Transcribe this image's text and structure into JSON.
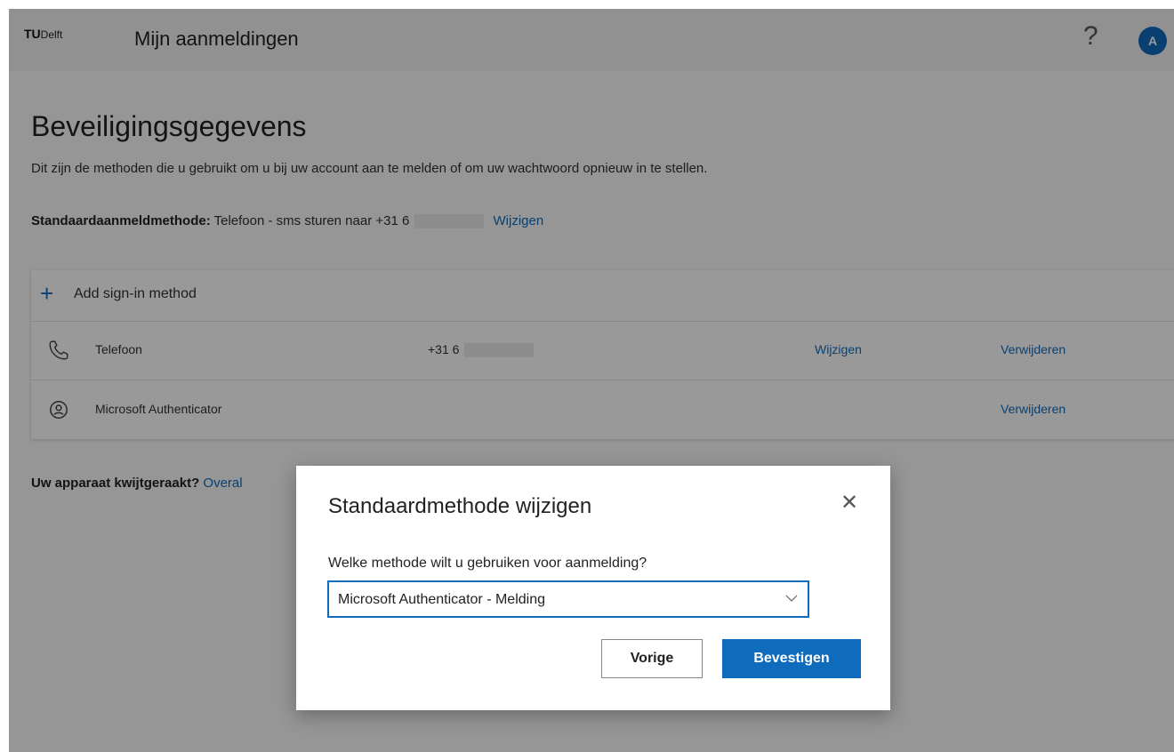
{
  "header": {
    "logo_tu": "TU",
    "logo_delft": "Delft",
    "app_title": "Mijn aanmeldingen",
    "help_symbol": "?",
    "avatar_initial": "A"
  },
  "main": {
    "title": "Beveiligingsgegevens",
    "subtitle": "Dit zijn de methoden die u gebruikt om u bij uw account aan te melden of om uw wachtwoord opnieuw in te stellen.",
    "default_label": "Standaardaanmeldmethode:",
    "default_value": "Telefoon - sms sturen naar +31 6",
    "default_change": "Wijzigen",
    "add_method": "Add sign-in method",
    "methods": [
      {
        "name": "Telefoon",
        "value": "+31 6",
        "change": "Wijzigen",
        "remove": "Verwijderen",
        "icon": "phone-icon"
      },
      {
        "name": "Microsoft Authenticator",
        "value": "",
        "change": "",
        "remove": "Verwijderen",
        "icon": "authenticator-icon"
      }
    ],
    "lost_label": "Uw apparaat kwijtgeraakt?",
    "lost_link": "Overal"
  },
  "dialog": {
    "title": "Standaardmethode wijzigen",
    "question": "Welke methode wilt u gebruiken voor aanmelding?",
    "selected_option": "Microsoft Authenticator - Melding",
    "back_label": "Vorige",
    "confirm_label": "Bevestigen"
  },
  "colors": {
    "accent": "#0f6cbd",
    "overlay": "rgba(0,0,0,0.4)"
  }
}
